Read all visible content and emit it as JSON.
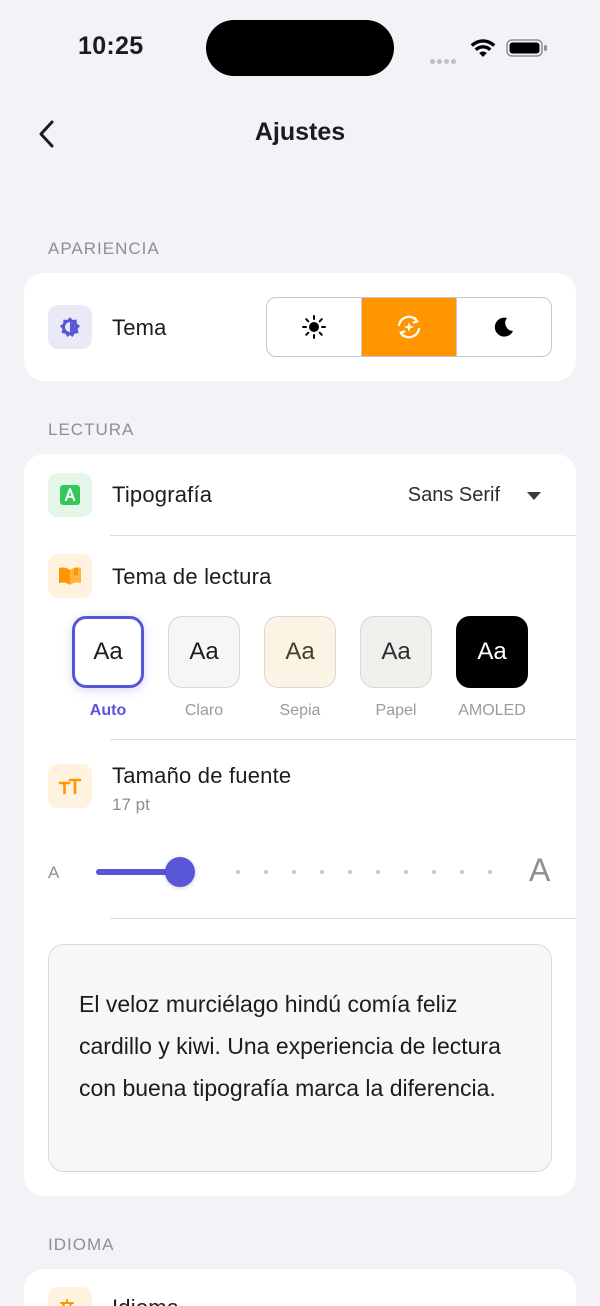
{
  "status_bar": {
    "time": "10:25"
  },
  "nav": {
    "title": "Ajustes"
  },
  "sections": {
    "appearance": "APARIENCIA",
    "reading": "LECTURA",
    "language": "IDIOMA"
  },
  "appearance": {
    "theme_label": "Tema",
    "theme_options": [
      "sun-icon",
      "auto-theme-icon",
      "moon-icon"
    ],
    "theme_selected": "auto",
    "accent_color": "#FF9500"
  },
  "reading": {
    "typography_label": "Tipografía",
    "typography_value": "Sans Serif",
    "reading_theme_label": "Tema de lectura",
    "swatch_sample": "Aa",
    "swatches": [
      {
        "caption": "Auto",
        "selected": true
      },
      {
        "caption": "Claro",
        "selected": false
      },
      {
        "caption": "Sepia",
        "selected": false
      },
      {
        "caption": "Papel",
        "selected": false
      },
      {
        "caption": "AMOLED",
        "selected": false
      }
    ],
    "font_size_label": "Tamaño de fuente",
    "font_size_value": "17 pt",
    "slider_small_label": "A",
    "slider_big_label": "A",
    "slider_fraction": 0.21,
    "slider_color": "#5856D6",
    "preview_text": "El veloz murciélago hindú comía feliz cardillo y kiwi. Una experiencia de lectura con buena tipografía marca la diferencia."
  },
  "language": {
    "label": "Idioma"
  }
}
